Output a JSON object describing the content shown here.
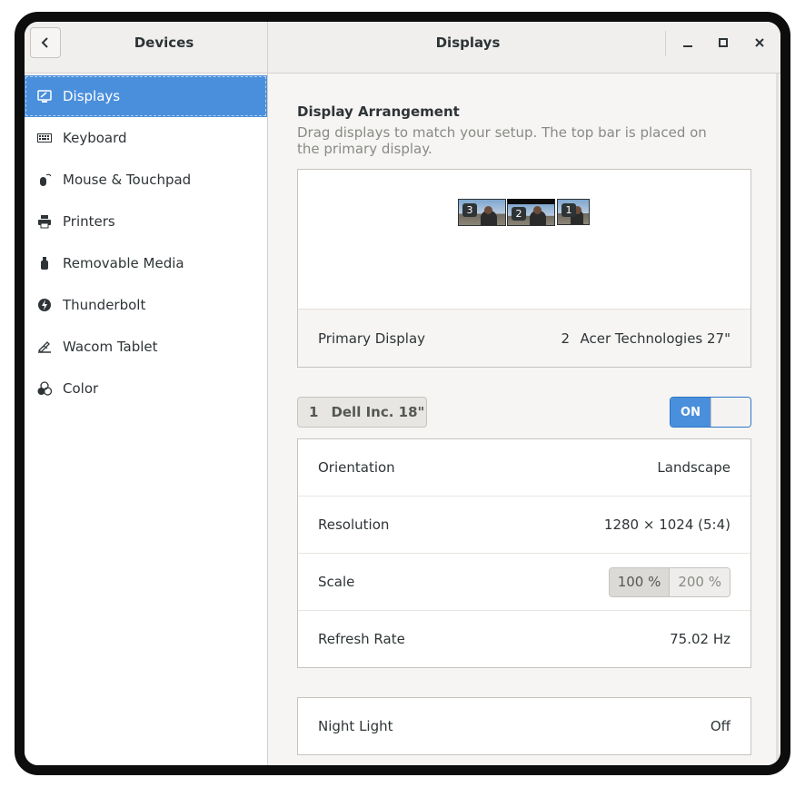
{
  "header": {
    "left_title": "Devices",
    "main_title": "Displays"
  },
  "sidebar": {
    "items": [
      {
        "label": "Displays",
        "icon": "display-icon",
        "active": true
      },
      {
        "label": "Keyboard",
        "icon": "keyboard-icon"
      },
      {
        "label": "Mouse & Touchpad",
        "icon": "mouse-icon"
      },
      {
        "label": "Printers",
        "icon": "printer-icon"
      },
      {
        "label": "Removable Media",
        "icon": "usb-drive-icon"
      },
      {
        "label": "Thunderbolt",
        "icon": "thunderbolt-icon"
      },
      {
        "label": "Wacom Tablet",
        "icon": "tablet-icon"
      },
      {
        "label": "Color",
        "icon": "color-icon"
      }
    ]
  },
  "arrangement": {
    "title": "Display Arrangement",
    "description": "Drag displays to match your setup. The top bar is placed on the primary display.",
    "monitors": [
      "3",
      "2",
      "1"
    ],
    "primary_label": "Primary Display",
    "primary_number": "2",
    "primary_name": "Acer Technologies 27\""
  },
  "selected_display": {
    "number": "1",
    "name": "Dell Inc. 18\"",
    "switch_label": "ON",
    "switch_on": true
  },
  "settings": {
    "orientation_label": "Orientation",
    "orientation_value": "Landscape",
    "resolution_label": "Resolution",
    "resolution_value": "1280 × 1024 (5:4)",
    "scale_label": "Scale",
    "scale_options": [
      "100 %",
      "200 %"
    ],
    "scale_selected": "100 %",
    "refresh_label": "Refresh Rate",
    "refresh_value": "75.02 Hz"
  },
  "night_light": {
    "label": "Night Light",
    "value": "Off"
  },
  "colors": {
    "accent": "#4a8fdc"
  }
}
